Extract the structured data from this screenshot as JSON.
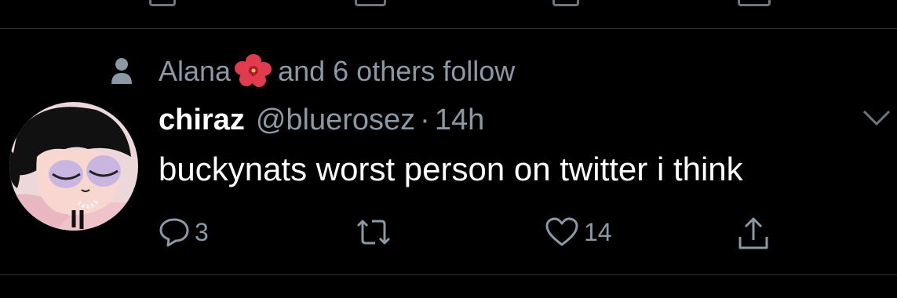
{
  "social_context": {
    "icon": "person-icon",
    "name": "Alana",
    "emoji": "hibiscus",
    "suffix": "and 6 others follow"
  },
  "tweet": {
    "display_name": "chiraz",
    "handle": "@bluerosez",
    "separator": "·",
    "time": "14h",
    "text": "buckynats worst person on twitter i think",
    "avatar": "avatar"
  },
  "actions": {
    "reply": {
      "icon": "reply-icon",
      "count": "3"
    },
    "retweet": {
      "icon": "retweet-icon",
      "count": ""
    },
    "like": {
      "icon": "heart-icon",
      "count": "14"
    },
    "share": {
      "icon": "share-icon",
      "count": ""
    }
  },
  "colors": {
    "background": "#000000",
    "text": "#ffffff",
    "secondary": "#8b98a5",
    "divider": "#2f3336"
  }
}
